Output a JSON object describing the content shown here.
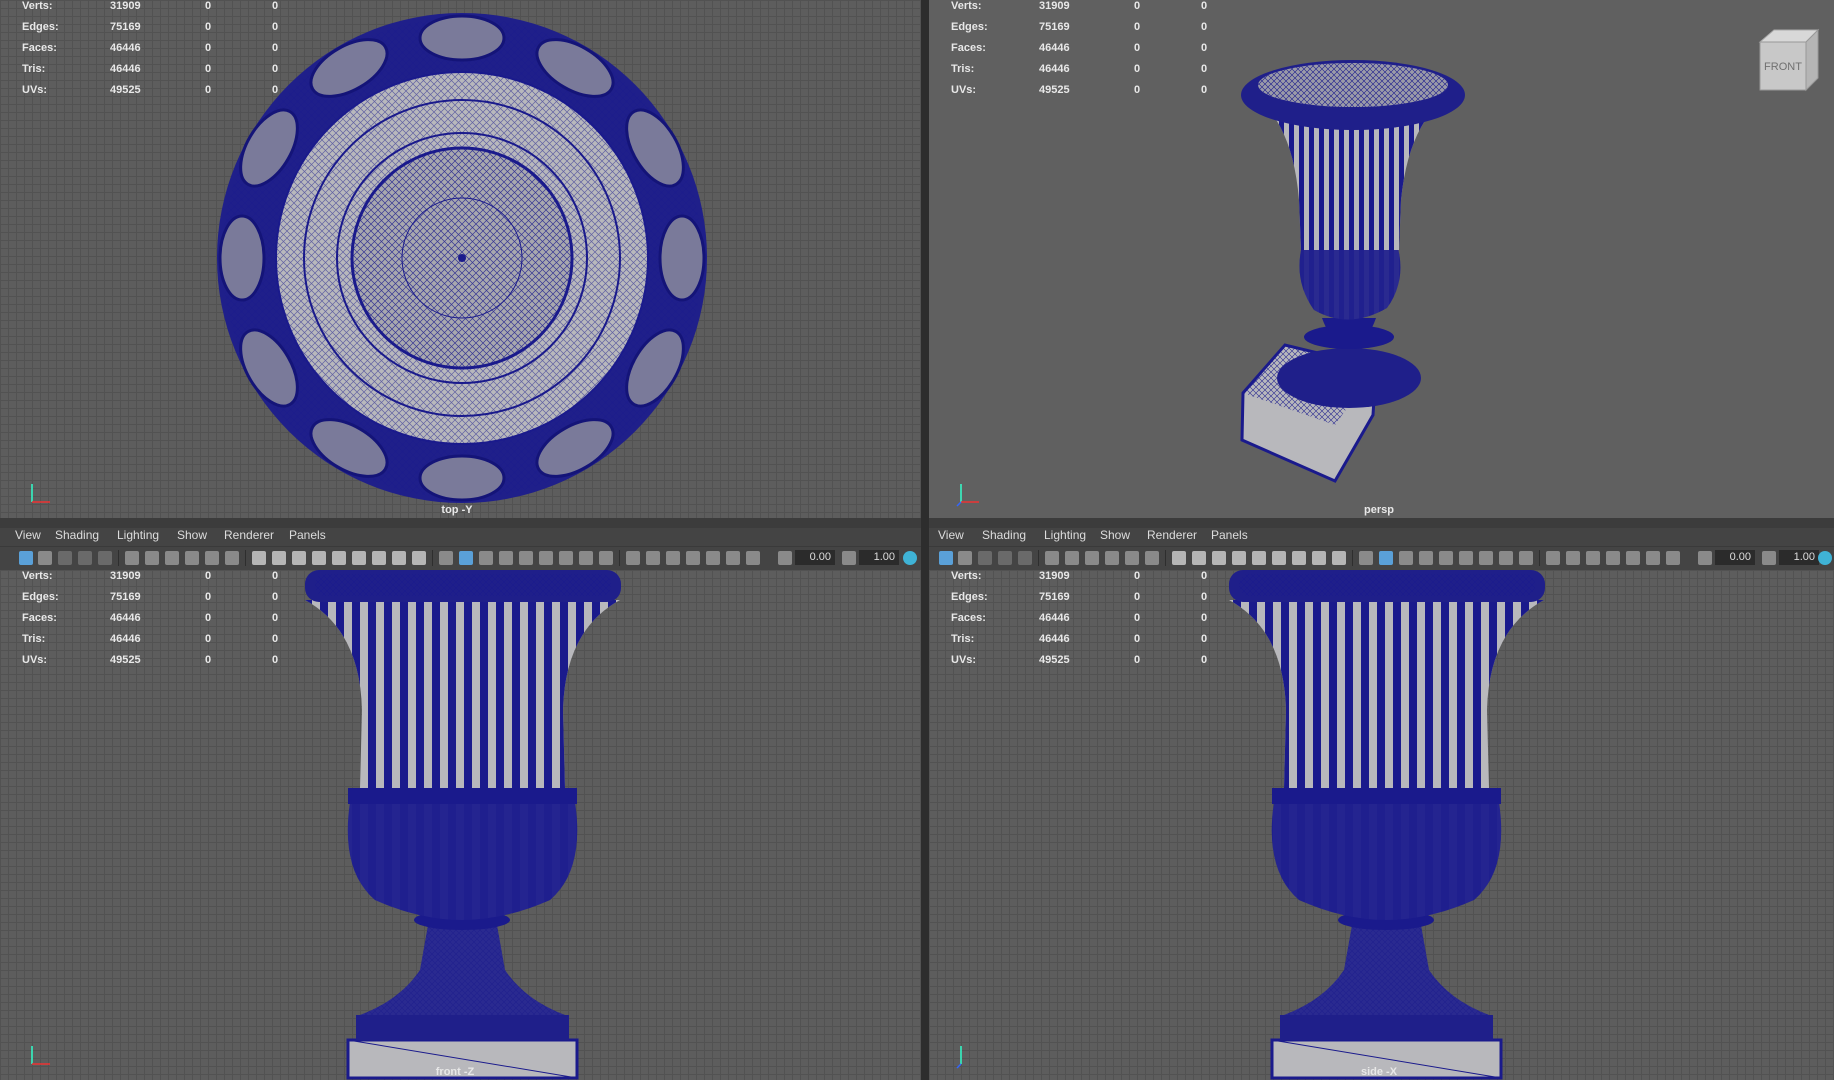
{
  "stats": {
    "rows": [
      {
        "label": "Verts:",
        "v1": "31909",
        "v2": "0",
        "v3": "0"
      },
      {
        "label": "Edges:",
        "v1": "75169",
        "v2": "0",
        "v3": "0"
      },
      {
        "label": "Faces:",
        "v1": "46446",
        "v2": "0",
        "v3": "0"
      },
      {
        "label": "Tris:",
        "v1": "46446",
        "v2": "0",
        "v3": "0"
      },
      {
        "label": "UVs:",
        "v1": "49525",
        "v2": "0",
        "v3": "0"
      }
    ]
  },
  "viewports": {
    "top": {
      "camera": "top -Y"
    },
    "persp": {
      "camera": "persp",
      "view_cube": "FRONT"
    },
    "front": {
      "camera": "front -Z"
    },
    "side": {
      "camera": "side -X"
    }
  },
  "menu": {
    "items": [
      "View",
      "Shading",
      "Lighting",
      "Show",
      "Renderer",
      "Panels"
    ]
  },
  "toolbar": {
    "exposure": "0.00",
    "gamma": "1.00"
  },
  "colors": {
    "wire": "#1a1a8c",
    "mesh_fill": "#b8b8bc",
    "viewport_bg": "#5d5d5d",
    "grid": "#525252"
  }
}
